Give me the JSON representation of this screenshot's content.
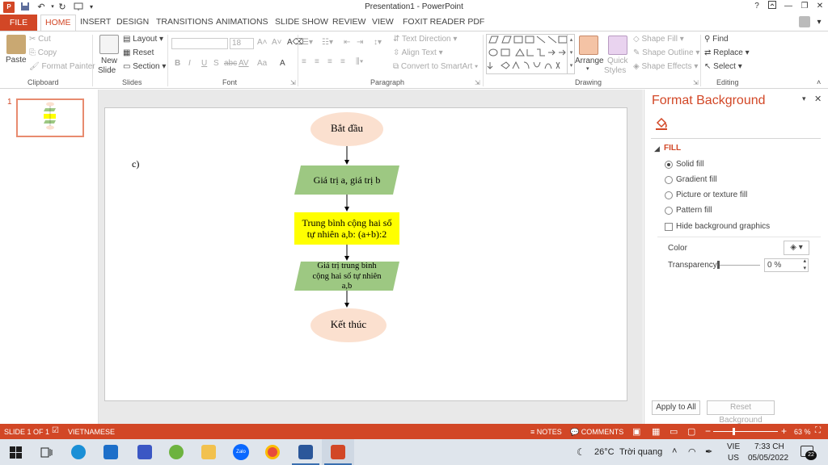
{
  "window": {
    "title": "Presentation1 - PowerPoint",
    "help": "?",
    "controls": [
      "restore",
      "minimize",
      "maximize",
      "close"
    ]
  },
  "quick_access": [
    "save-icon",
    "undo-icon",
    "redo-icon",
    "present-icon",
    "customize-icon"
  ],
  "tabs": [
    "FILE",
    "HOME",
    "INSERT",
    "DESIGN",
    "TRANSITIONS",
    "ANIMATIONS",
    "SLIDE SHOW",
    "REVIEW",
    "VIEW",
    "FOXIT READER PDF"
  ],
  "active_tab": "HOME",
  "ribbon": {
    "clipboard": {
      "label": "Clipboard",
      "paste": "Paste",
      "cut": "Cut",
      "copy": "Copy",
      "format_painter": "Format Painter"
    },
    "slides": {
      "label": "Slides",
      "new_slide_1": "New",
      "new_slide_2": "Slide",
      "layout": "Layout",
      "reset": "Reset",
      "section": "Section"
    },
    "font": {
      "label": "Font",
      "size": "18",
      "buttons": [
        "B",
        "I",
        "U",
        "S",
        "abc",
        "AV",
        "Aa",
        "A"
      ]
    },
    "paragraph": {
      "label": "Paragraph",
      "text_direction": "Text Direction",
      "align_text": "Align Text",
      "convert_smartart": "Convert to SmartArt"
    },
    "drawing": {
      "label": "Drawing",
      "arrange": "Arrange",
      "quick_styles_1": "Quick",
      "quick_styles_2": "Styles",
      "shape_fill": "Shape Fill",
      "shape_outline": "Shape Outline",
      "shape_effects": "Shape Effects"
    },
    "editing": {
      "label": "Editing",
      "find": "Find",
      "replace": "Replace",
      "select": "Select"
    }
  },
  "thumbnails": [
    {
      "number": "1"
    }
  ],
  "slide": {
    "label_c": "c)",
    "flowchart": {
      "start": "Bắt đầu",
      "input": "Giá trị a, giá trị b",
      "process_line1": "Trung bình cộng hai số",
      "process_line2": "tự nhiên a,b: (a+b):2",
      "output_line1": "Giá trị trung bình",
      "output_line2": "cộng hai số tự nhiên",
      "output_line3": "a,b",
      "end": "Kết thúc"
    },
    "colors": {
      "terminal": "#fbe0cf",
      "io": "#9dc882",
      "process": "#ffff00"
    }
  },
  "format_pane": {
    "title": "Format Background",
    "fill_section": "FILL",
    "options": [
      "Solid fill",
      "Gradient fill",
      "Picture or texture fill",
      "Pattern fill"
    ],
    "selected": "Solid fill",
    "hide_bg": "Hide background graphics",
    "color_label": "Color",
    "transparency_label": "Transparency",
    "transparency_value": "0 %",
    "transparency": 0,
    "apply_all": "Apply to All",
    "reset_bg": "Reset Background"
  },
  "status": {
    "slide_info": "SLIDE 1 OF 1",
    "language": "VIETNAMESE",
    "notes": "NOTES",
    "comments": "COMMENTS",
    "zoom": "63 %",
    "zoom_minus": "−",
    "zoom_plus": "+"
  },
  "taskbar": {
    "apps": [
      "windows-icon",
      "task-view-icon",
      "edge-icon",
      "mail-icon",
      "azure-icon",
      "coccoc-icon",
      "file-explorer-icon",
      "zalo-icon",
      "chrome-icon",
      "word-icon",
      "powerpoint-icon"
    ],
    "zalo": "Zalo",
    "weather_temp": "26°C",
    "weather_desc": "Trời quang",
    "lang_1": "VIE",
    "lang_2": "US",
    "time": "7:33 CH",
    "date": "05/05/2022",
    "notif_count": "22"
  }
}
